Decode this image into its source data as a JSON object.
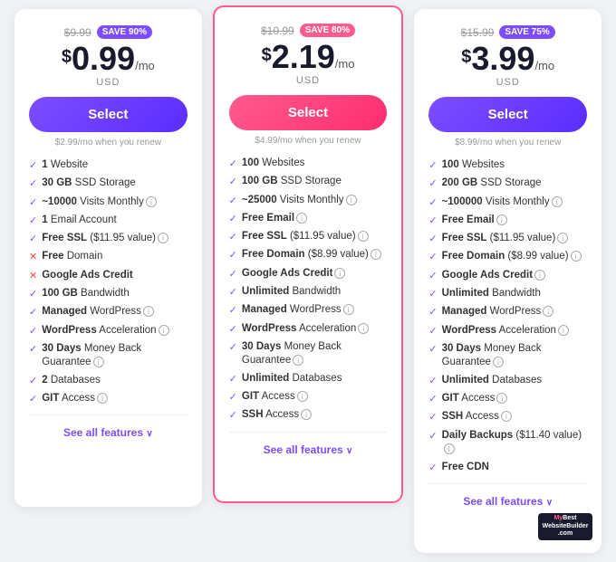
{
  "plans": [
    {
      "id": "basic",
      "original_price": "$9.99",
      "save_badge": "SAVE 90%",
      "badge_style": "purple",
      "price": "0.99",
      "per_mo": "/mo",
      "currency": "USD",
      "select_label": "Select",
      "button_style": "purple",
      "renew_note": "$2.99/mo when you renew",
      "features": [
        {
          "check": true,
          "text": "1 Website",
          "bold_part": "1 ",
          "info": false
        },
        {
          "check": true,
          "text": "30 GB SSD Storage",
          "bold_part": "30 GB",
          "info": false
        },
        {
          "check": true,
          "text": "~10000 Visits Monthly",
          "bold_part": "~10000",
          "info": true
        },
        {
          "check": true,
          "text": "1 Email Account",
          "bold_part": "1",
          "info": false
        },
        {
          "check": true,
          "text": "Free SSL ($11.95 value)",
          "bold_part": "Free SSL",
          "info": true
        },
        {
          "check": false,
          "text": "Free Domain",
          "bold_part": "Free",
          "info": false
        },
        {
          "check": false,
          "text": "Google Ads Credit",
          "bold_part": "Google Ads Credit",
          "info": false
        },
        {
          "check": true,
          "text": "100 GB Bandwidth",
          "bold_part": "100 GB",
          "info": false
        },
        {
          "check": true,
          "text": "Managed WordPress",
          "bold_part": "Managed",
          "info": true
        },
        {
          "check": true,
          "text": "WordPress Acceleration",
          "bold_part": "WordPress",
          "info": true
        },
        {
          "check": true,
          "text": "30 Days Money Back Guarantee",
          "bold_part": "30 Days",
          "info": true
        },
        {
          "check": true,
          "text": "2 Databases",
          "bold_part": "2",
          "info": false
        },
        {
          "check": true,
          "text": "GIT Access",
          "bold_part": "GIT",
          "info": true
        }
      ],
      "see_all": "See all features"
    },
    {
      "id": "premium",
      "original_price": "$10.99",
      "save_badge": "SAVE 80%",
      "badge_style": "pink",
      "price": "2.19",
      "per_mo": "/mo",
      "currency": "USD",
      "select_label": "Select",
      "button_style": "pink",
      "renew_note": "$4.99/mo when you renew",
      "features": [
        {
          "check": true,
          "text": "100 Websites",
          "bold_part": "100",
          "info": false
        },
        {
          "check": true,
          "text": "100 GB SSD Storage",
          "bold_part": "100 GB",
          "info": false
        },
        {
          "check": true,
          "text": "~25000 Visits Monthly",
          "bold_part": "~25000",
          "info": true
        },
        {
          "check": true,
          "text": "Free Email",
          "bold_part": "Free Email",
          "info": true
        },
        {
          "check": true,
          "text": "Free SSL ($11.95 value)",
          "bold_part": "Free SSL",
          "info": true
        },
        {
          "check": true,
          "text": "Free Domain ($8.99 value)",
          "bold_part": "Free Domain",
          "info": true
        },
        {
          "check": true,
          "text": "Google Ads Credit",
          "bold_part": "Google Ads Credit",
          "info": true
        },
        {
          "check": true,
          "text": "Unlimited Bandwidth",
          "bold_part": "Unlimited",
          "info": false
        },
        {
          "check": true,
          "text": "Managed WordPress",
          "bold_part": "Managed",
          "info": true
        },
        {
          "check": true,
          "text": "WordPress Acceleration",
          "bold_part": "WordPress",
          "info": true
        },
        {
          "check": true,
          "text": "30 Days Money Back Guarantee",
          "bold_part": "30 Days",
          "info": true
        },
        {
          "check": true,
          "text": "Unlimited Databases",
          "bold_part": "Unlimited",
          "info": false
        },
        {
          "check": true,
          "text": "GIT Access",
          "bold_part": "GIT",
          "info": true
        },
        {
          "check": true,
          "text": "SSH Access",
          "bold_part": "SSH",
          "info": true
        }
      ],
      "see_all": "See all features"
    },
    {
      "id": "business",
      "original_price": "$15.99",
      "save_badge": "SAVE 75%",
      "badge_style": "purple",
      "price": "3.99",
      "per_mo": "/mo",
      "currency": "USD",
      "select_label": "Select",
      "button_style": "purple",
      "renew_note": "$8.99/mo when you renew",
      "features": [
        {
          "check": true,
          "text": "100 Websites",
          "bold_part": "100",
          "info": false
        },
        {
          "check": true,
          "text": "200 GB SSD Storage",
          "bold_part": "200 GB",
          "info": false
        },
        {
          "check": true,
          "text": "~100000 Visits Monthly",
          "bold_part": "~100000",
          "info": true
        },
        {
          "check": true,
          "text": "Free Email",
          "bold_part": "Free Email",
          "info": true
        },
        {
          "check": true,
          "text": "Free SSL ($11.95 value)",
          "bold_part": "Free SSL",
          "info": true
        },
        {
          "check": true,
          "text": "Free Domain ($8.99 value)",
          "bold_part": "Free Domain",
          "info": true
        },
        {
          "check": true,
          "text": "Google Ads Credit",
          "bold_part": "Google Ads Credit",
          "info": true
        },
        {
          "check": true,
          "text": "Unlimited Bandwidth",
          "bold_part": "Unlimited",
          "info": false
        },
        {
          "check": true,
          "text": "Managed WordPress",
          "bold_part": "Managed",
          "info": true
        },
        {
          "check": true,
          "text": "WordPress Acceleration",
          "bold_part": "WordPress",
          "info": true
        },
        {
          "check": true,
          "text": "30 Days Money Back Guarantee",
          "bold_part": "30 Days",
          "info": true
        },
        {
          "check": true,
          "text": "Unlimited Databases",
          "bold_part": "Unlimited",
          "info": false
        },
        {
          "check": true,
          "text": "GIT Access",
          "bold_part": "GIT",
          "info": true
        },
        {
          "check": true,
          "text": "SSH Access",
          "bold_part": "SSH",
          "info": true
        },
        {
          "check": true,
          "text": "Daily Backups ($11.40 value)",
          "bold_part": "Daily Backups",
          "info": true
        },
        {
          "check": true,
          "text": "Free CDN",
          "bold_part": "Free CDN",
          "info": false
        }
      ],
      "see_all": "See all features"
    }
  ],
  "watermark": {
    "line1": "MyBest",
    "line2": "WebsiteBuilder.com"
  }
}
